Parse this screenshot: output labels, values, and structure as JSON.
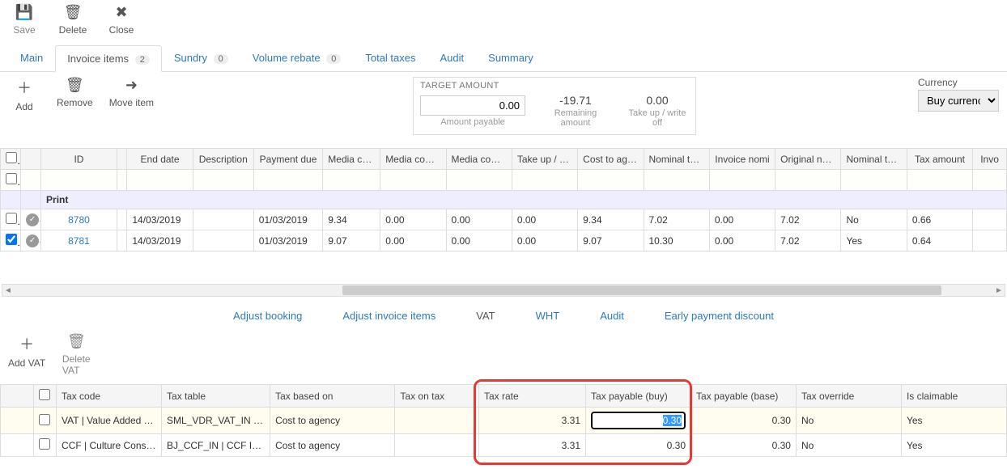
{
  "toolbar": {
    "save": "Save",
    "delete": "Delete",
    "close": "Close"
  },
  "tabs": {
    "main": "Main",
    "invoice_items": "Invoice items",
    "invoice_items_badge": "2",
    "sundry": "Sundry",
    "sundry_badge": "0",
    "volume_rebate": "Volume rebate",
    "volume_rebate_badge": "0",
    "total_taxes": "Total taxes",
    "audit": "Audit",
    "summary": "Summary"
  },
  "sub_toolbar": {
    "add": "Add",
    "remove": "Remove",
    "move_item": "Move item"
  },
  "target": {
    "title": "TARGET AMOUNT",
    "amount_payable_value": "0.00",
    "amount_payable_label": "Amount payable",
    "remaining_value": "-19.71",
    "remaining_label": "Remaining amount",
    "takeup_value": "0.00",
    "takeup_label": "Take up / write off"
  },
  "currency": {
    "label": "Currency",
    "value": "Buy currency"
  },
  "grid": {
    "headers": {
      "id": "ID",
      "end": "End date",
      "desc": "Description",
      "pd": "Payment due",
      "mc": "Media cost",
      "mcm1": "Media commi",
      "mcm2": "Media commi",
      "tu": "Take up / writ",
      "cta": "Cost to agenc",
      "ntr": "Nominal tax r",
      "in": "Invoice nomi",
      "on": "Original nomi",
      "ntc": "Nominal tax c",
      "ta": "Tax amount",
      "inv": "Invo"
    },
    "group": {
      "label": "Print"
    },
    "rows": [
      {
        "checked": false,
        "id": "8780",
        "end": "14/03/2019",
        "desc": "",
        "pd": "01/03/2019",
        "mc": "9.34",
        "mcm1": "0.00",
        "mcm2": "0.00",
        "tu": "0.00",
        "cta": "9.34",
        "ntr": "7.02",
        "in": "0.00",
        "on": "7.02",
        "ntc": "No",
        "ta": "0.66"
      },
      {
        "checked": true,
        "id": "8781",
        "end": "14/03/2019",
        "desc": "",
        "pd": "01/03/2019",
        "mc": "9.07",
        "mcm1": "0.00",
        "mcm2": "0.00",
        "tu": "0.00",
        "cta": "9.07",
        "ntr": "10.30",
        "in": "0.00",
        "on": "7.02",
        "ntc": "Yes",
        "ta": "0.64"
      }
    ]
  },
  "sub_tabs": {
    "adjust_booking": "Adjust booking",
    "adjust_invoice": "Adjust invoice items",
    "vat": "VAT",
    "wht": "WHT",
    "audit": "Audit",
    "epd": "Early payment discount"
  },
  "vat_toolbar": {
    "add_vat": "Add VAT",
    "delete_vat": "Delete VAT"
  },
  "vat_grid": {
    "headers": {
      "tax_code": "Tax code",
      "tax_table": "Tax table",
      "tax_based_on": "Tax based on",
      "tax_on_tax": "Tax on tax",
      "tax_rate": "Tax rate",
      "tax_payable_buy": "Tax payable (buy)",
      "tax_payable_base": "Tax payable (base)",
      "tax_override": "Tax override",
      "is_claimable": "Is claimable"
    },
    "rows": [
      {
        "tax_code": "VAT | Value Added Tax",
        "tax_table": "SML_VDR_VAT_IN |…",
        "tax_based_on": "Cost to agency",
        "tax_on_tax": "",
        "tax_rate": "3.31",
        "tax_payable_buy": "0.30",
        "tax_payable_base": "0.30",
        "tax_override": "No",
        "is_claimable": "Yes"
      },
      {
        "tax_code": "CCF | Culture Cons…",
        "tax_table": "BJ_CCF_IN | CCF I…",
        "tax_based_on": "Cost to agency",
        "tax_on_tax": "",
        "tax_rate": "3.31",
        "tax_payable_buy": "0.30",
        "tax_payable_base": "0.30",
        "tax_override": "No",
        "is_claimable": "Yes"
      }
    ]
  }
}
